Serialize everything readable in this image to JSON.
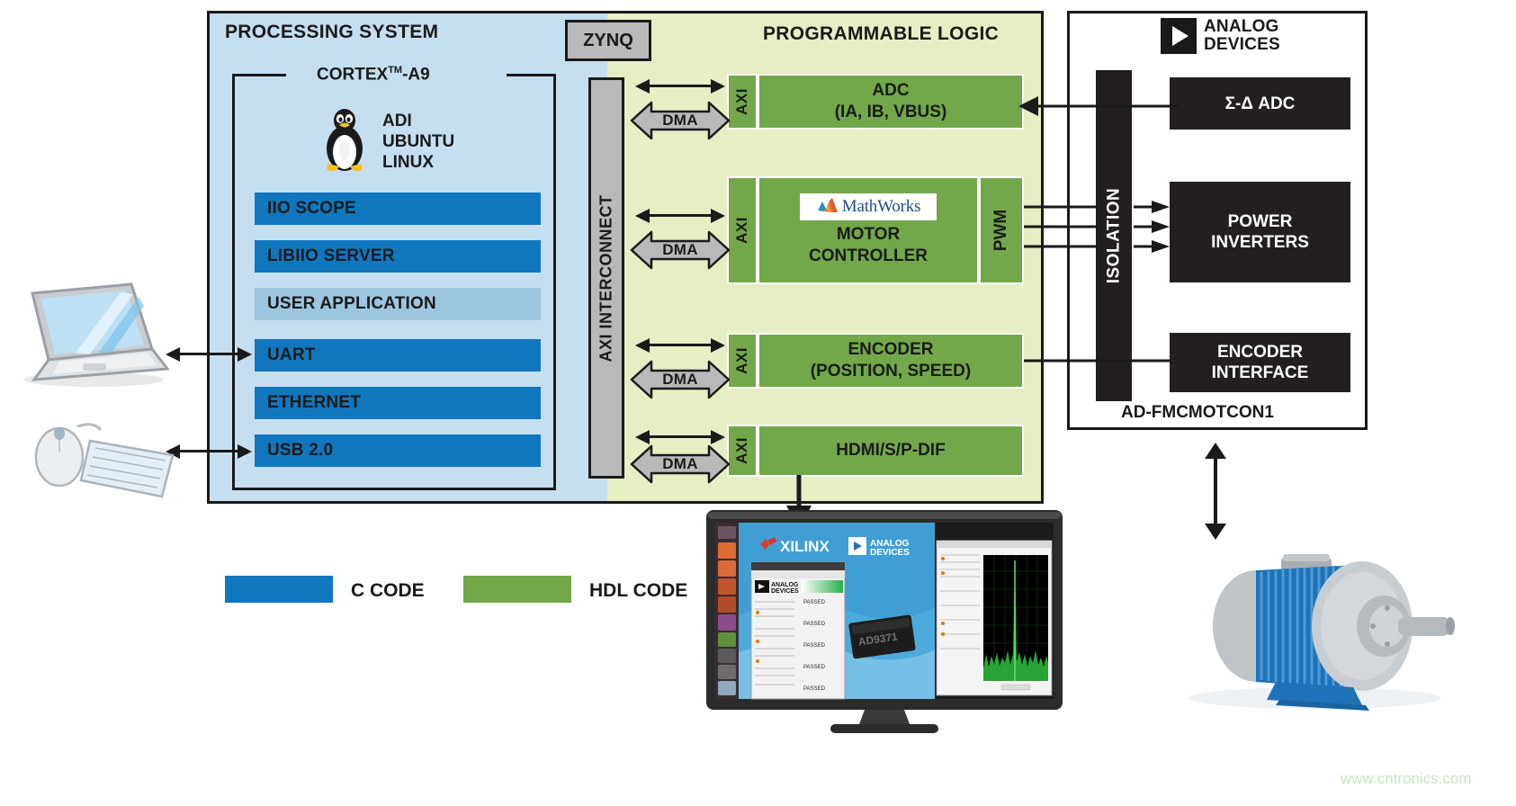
{
  "diagram": {
    "title": "Zynq motor control platform block diagram",
    "watermark": "www.cntronics.com"
  },
  "processing_system": {
    "title": "PROCESSING SYSTEM",
    "cortex_label": "CORTEX",
    "cortex_tm": "TM",
    "cortex_suffix": "-A9",
    "os_lines": [
      "ADI",
      "UBUNTU",
      "LINUX"
    ],
    "os_text": "ADI\nUBUNTU\nLINUX",
    "penguin_icon": "linux-penguin-icon",
    "software_blocks": [
      {
        "label": "IIO SCOPE",
        "style": "dark"
      },
      {
        "label": "LIBIIO SERVER",
        "style": "dark"
      },
      {
        "label": "USER APPLICATION",
        "style": "light"
      },
      {
        "label": "UART",
        "style": "dark"
      },
      {
        "label": "ETHERNET",
        "style": "dark"
      },
      {
        "label": "USB 2.0",
        "style": "dark"
      }
    ]
  },
  "zynq": {
    "label": "ZYNQ"
  },
  "interconnect": {
    "label": "AXI INTERCONNECT"
  },
  "programmable_logic": {
    "title": "PROGRAMMABLE LOGIC",
    "rows": [
      {
        "axi": "AXI",
        "dma": "DMA",
        "line1": "ADC",
        "line2": "(IA, IB, VBUS)",
        "has_logo": false,
        "has_pwm": false
      },
      {
        "axi": "AXI",
        "dma": "DMA",
        "line1": "MOTOR",
        "line2": "CONTROLLER",
        "has_logo": true,
        "logo_text": "MathWorks",
        "has_pwm": true,
        "pwm": "PWM"
      },
      {
        "axi": "AXI",
        "dma": "DMA",
        "line1": "ENCODER",
        "line2": "(POSITION, SPEED)",
        "has_logo": false,
        "has_pwm": false
      },
      {
        "axi": "AXI",
        "dma": "DMA",
        "line1": "HDMI/S/P-DIF",
        "line2": "",
        "has_logo": false,
        "has_pwm": false
      }
    ]
  },
  "adi_board": {
    "brand_line1": "ANALOG",
    "brand_line2": "DEVICES",
    "isolation": "ISOLATION",
    "board_name": "AD-FMCMOTCON1",
    "blocks": [
      {
        "label": "Σ-Δ ADC"
      },
      {
        "label": "POWER\nINVERTERS",
        "line1": "POWER",
        "line2": "INVERTERS"
      },
      {
        "label": "ENCODER\nINTERFACE",
        "line1": "ENCODER",
        "line2": "INTERFACE"
      }
    ]
  },
  "legend": {
    "items": [
      {
        "label": "C CODE",
        "color": "#1077be"
      },
      {
        "label": "HDL CODE",
        "color": "#72a84a"
      }
    ]
  },
  "peripherals": {
    "laptop": "laptop-icon",
    "mouse": "mouse-icon",
    "keyboard": "keyboard-icon",
    "monitor": "monitor-icon",
    "motor": "electric-motor-icon",
    "monitor_screen": {
      "brand_left": "XILINX",
      "brand_right_line1": "ANALOG",
      "brand_right_line2": "DEVICES",
      "window_brand_line1": "ANALOG",
      "window_brand_line2": "DEVICES",
      "chip_label": "AD9371"
    }
  },
  "colors": {
    "c_code_blue": "#1077be",
    "c_code_blue_light": "#9cc6e0",
    "hdl_green": "#72a84a",
    "ps_background": "#c5dff0",
    "pl_background": "#e6eec4",
    "gray_bar": "#b9b9b9",
    "black_block": "#231f20",
    "watermark_green": "#c8e6c0"
  }
}
